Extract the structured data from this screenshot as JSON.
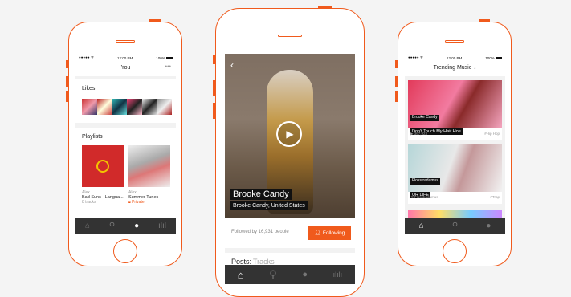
{
  "left_phone": {
    "status": {
      "carrier": "●●●●● ᯤ",
      "time": "12:00 PM",
      "battery": "100%"
    },
    "title": "You",
    "more": "•••",
    "likes_heading": "Likes",
    "playlists_heading": "Playlists",
    "playlists": [
      {
        "artist": "Alex",
        "title": "Bad Suns - Langua...",
        "meta": "8 tracks"
      },
      {
        "artist": "Alex",
        "title": "Summer Tunes",
        "meta": "Private"
      }
    ]
  },
  "center_phone": {
    "artist_name": "Brooke Candy",
    "subtitle": "Brooke Candy, United States",
    "followers": "Followed by 16,931 people",
    "following_label": "Following",
    "posts_label": "Posts:",
    "tracks_label": "Tracks"
  },
  "right_phone": {
    "status": {
      "carrier": "●●●●● ᯤ",
      "time": "12:00 PM",
      "battery": "100%"
    },
    "title": "Trending Music",
    "tracks": [
      {
        "artist": "Brooke Candy",
        "title": "Don't Touch My Hair Hoe",
        "plays": "367,923",
        "tag": "#Hip Hop"
      },
      {
        "artist": "Flosstradamus",
        "title": "UR LIFE",
        "plays": "Flosstradamus",
        "tag": "#Trap"
      }
    ]
  },
  "colors": {
    "accent": "#f05a1c",
    "tabbar": "#333333"
  }
}
